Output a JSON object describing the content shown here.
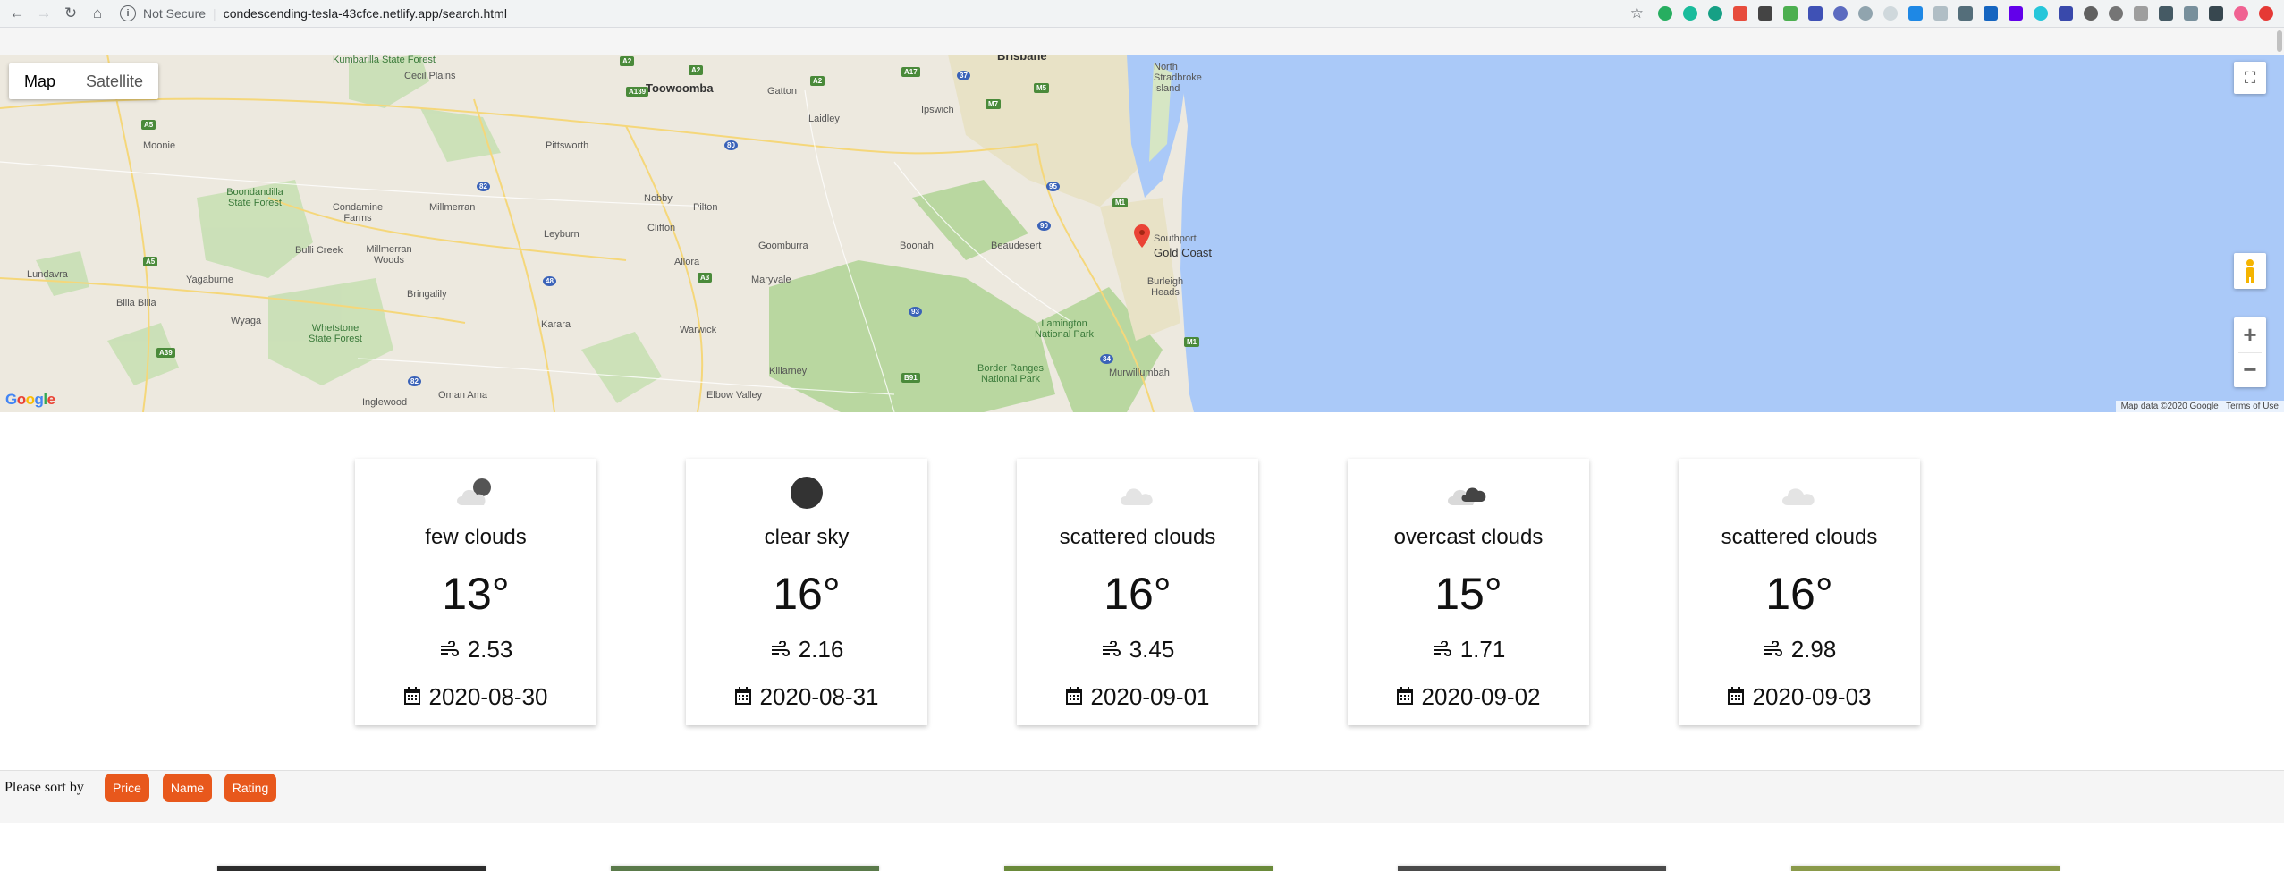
{
  "browser": {
    "security_label": "Not Secure",
    "url": "condescending-tesla-43cfce.netlify.app/search.html"
  },
  "map": {
    "type_options": [
      "Map",
      "Satellite"
    ],
    "active_type": "Map",
    "attribution": "Map data ©2020 Google",
    "terms": "Terms of Use",
    "logo": "Google",
    "labels": {
      "kumbarilla": "Kumbarilla State Forest",
      "cecil_plains": "Cecil Plains",
      "toowoomba": "Toowoomba",
      "gatton": "Gatton",
      "laidley": "Laidley",
      "ipswich": "Ipswich",
      "brisbane": "Brisbane",
      "north_stradbroke": "North Stradbroke Island",
      "moonie": "Moonie",
      "pittsworth": "Pittsworth",
      "boondandilla": "Boondandilla State Forest",
      "condamine": "Condamine Farms",
      "millmerran": "Millmerran",
      "nobby": "Nobby",
      "pilton": "Pilton",
      "leyburn": "Leyburn",
      "clifton": "Clifton",
      "goomburra": "Goomburra",
      "boonah": "Boonah",
      "beaudesert": "Beaudesert",
      "southport": "Southport",
      "gold_coast": "Gold Coast",
      "burleigh": "Burleigh Heads",
      "lundavra": "Lundavra",
      "bulli_creek": "Bulli Creek",
      "millmerran_woods": "Millmerran Woods",
      "yagaburne": "Yagaburne",
      "allora": "Allora",
      "maryvale": "Maryvale",
      "billa_billa": "Billa Billa",
      "bringalily": "Bringalily",
      "wyaga": "Wyaga",
      "whetstone": "Whetstone State Forest",
      "karara": "Karara",
      "warwick": "Warwick",
      "lamington": "Lamington National Park",
      "killarney": "Killarney",
      "border_ranges": "Border Ranges National Park",
      "murwillumbah": "Murwillumbah",
      "inglewood": "Inglewood",
      "oman_ama": "Oman Ama",
      "elbow_valley": "Elbow Valley"
    }
  },
  "forecast": [
    {
      "description": "few clouds",
      "temp": "13°",
      "wind": "2.53",
      "date": "2020-08-30",
      "icon": "few-clouds-icon"
    },
    {
      "description": "clear sky",
      "temp": "16°",
      "wind": "2.16",
      "date": "2020-08-31",
      "icon": "clear-sky-icon"
    },
    {
      "description": "scattered clouds",
      "temp": "16°",
      "wind": "3.45",
      "date": "2020-09-01",
      "icon": "scattered-clouds-icon"
    },
    {
      "description": "overcast clouds",
      "temp": "15°",
      "wind": "1.71",
      "date": "2020-09-02",
      "icon": "overcast-clouds-icon"
    },
    {
      "description": "scattered clouds",
      "temp": "16°",
      "wind": "2.98",
      "date": "2020-09-03",
      "icon": "scattered-clouds-icon"
    }
  ],
  "sort": {
    "label": "Please sort by",
    "buttons": [
      "Price",
      "Name",
      "Rating"
    ],
    "button_color": "#e8581c"
  }
}
